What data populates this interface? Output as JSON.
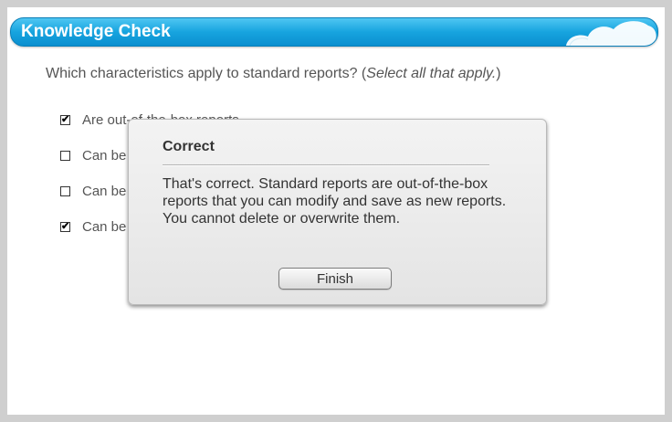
{
  "header": {
    "title": "Knowledge Check"
  },
  "question": {
    "text": "Which characteristics apply to standard reports? (",
    "hint": "Select all that apply.",
    "close": ")"
  },
  "options": [
    {
      "label": "Are out-of-the-box reports",
      "checked": true,
      "check_glyph": "✔"
    },
    {
      "label": "Can be",
      "checked": false,
      "check_glyph": ""
    },
    {
      "label": "Can be",
      "checked": false,
      "check_glyph": ""
    },
    {
      "label": "Can be",
      "checked": true,
      "check_glyph": "✔"
    }
  ],
  "dialog": {
    "title": "Correct",
    "message": "That's correct. Standard reports are out-of-the-box reports that you can modify and save as new reports. You cannot delete or overwrite them.",
    "button_label": "Finish"
  },
  "colors": {
    "header_blue": "#17a4df",
    "text_gray": "#555555"
  },
  "icons": {
    "header_decoration": "cloud-icon",
    "checked_mark": "checkmark-icon"
  }
}
